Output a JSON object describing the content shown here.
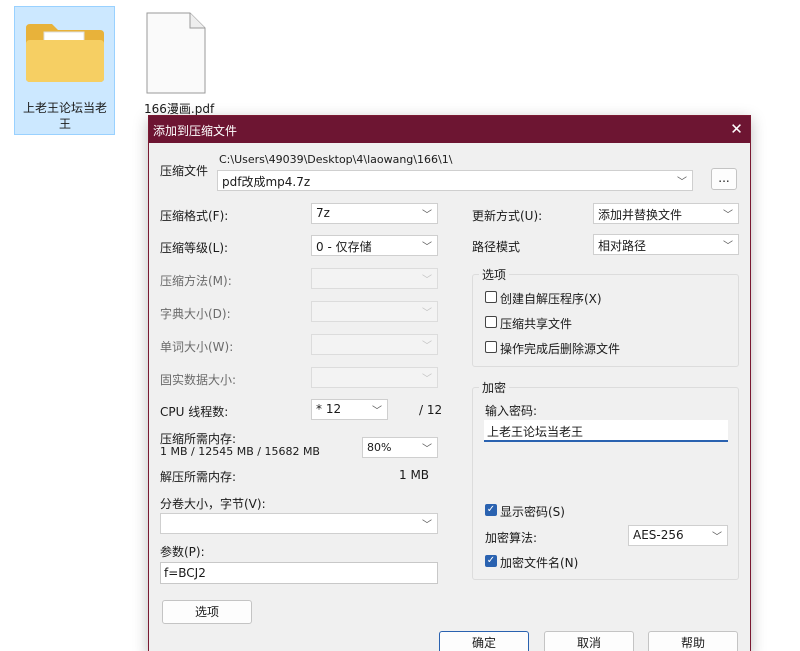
{
  "desktop": {
    "folder_label": "上老王论坛当老王",
    "pdf_label": "166漫画.pdf"
  },
  "dialog": {
    "title": "添加到压缩文件",
    "archive": {
      "label": "压缩文件",
      "path": "C:\\Users\\49039\\Desktop\\4\\laowang\\166\\1\\",
      "name": "pdf改成mp4.7z",
      "browse_label": "..."
    },
    "left": {
      "format_label": "压缩格式(F):",
      "format_value": "7z",
      "level_label": "压缩等级(L):",
      "level_value": "0 - 仅存储",
      "method_label": "压缩方法(M):",
      "dict_label": "字典大小(D):",
      "word_label": "单词大小(W):",
      "solid_label": "固实数据大小:",
      "cpu_label": "CPU 线程数:",
      "cpu_value": "* 12",
      "cpu_total": "/ 12",
      "mem_label": "压缩所需内存:",
      "mem_detail": "1 MB / 12545 MB / 15682 MB",
      "mem_percent": "80%",
      "decomp_label": "解压所需内存:",
      "decomp_value": "1 MB",
      "volume_label": "分卷大小，字节(V):",
      "volume_value": "",
      "params_label": "参数(P):",
      "params_value": "f=BCJ2",
      "options_button": "选项"
    },
    "right": {
      "update_label": "更新方式(U):",
      "update_value": "添加并替换文件",
      "path_label": "路径模式",
      "path_value": "相对路径",
      "options_group": "选项",
      "opt_sfx": "创建自解压程序(X)",
      "opt_shared": "压缩共享文件",
      "opt_delete": "操作完成后删除源文件",
      "encrypt_group": "加密",
      "password_label": "输入密码:",
      "password_value": "上老王论坛当老王",
      "show_password": "显示密码(S)",
      "algo_label": "加密算法:",
      "algo_value": "AES-256",
      "encrypt_names": "加密文件名(N)"
    },
    "buttons": {
      "ok": "确定",
      "cancel": "取消",
      "help": "帮助"
    }
  },
  "colors": {
    "titlebar": "#6d1532",
    "accent": "#2a62b0",
    "dialog_bg": "#f0f0f0"
  }
}
